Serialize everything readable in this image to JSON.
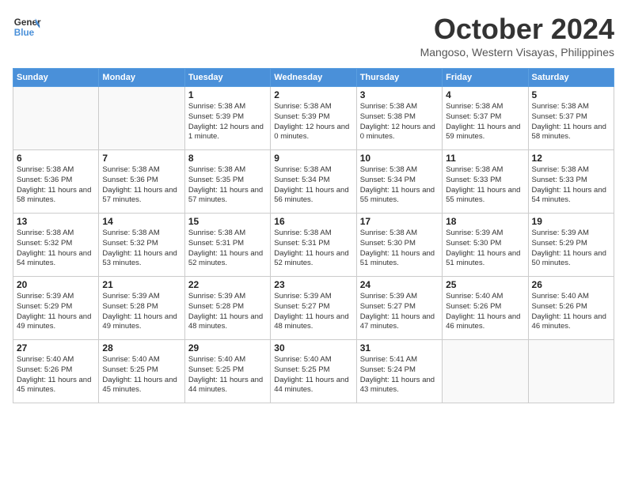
{
  "header": {
    "logo_line1": "General",
    "logo_line2": "Blue",
    "month_year": "October 2024",
    "location": "Mangoso, Western Visayas, Philippines"
  },
  "weekdays": [
    "Sunday",
    "Monday",
    "Tuesday",
    "Wednesday",
    "Thursday",
    "Friday",
    "Saturday"
  ],
  "weeks": [
    [
      {
        "day": "",
        "sunrise": "",
        "sunset": "",
        "daylight": ""
      },
      {
        "day": "",
        "sunrise": "",
        "sunset": "",
        "daylight": ""
      },
      {
        "day": "1",
        "sunrise": "Sunrise: 5:38 AM",
        "sunset": "Sunset: 5:39 PM",
        "daylight": "Daylight: 12 hours and 1 minute."
      },
      {
        "day": "2",
        "sunrise": "Sunrise: 5:38 AM",
        "sunset": "Sunset: 5:39 PM",
        "daylight": "Daylight: 12 hours and 0 minutes."
      },
      {
        "day": "3",
        "sunrise": "Sunrise: 5:38 AM",
        "sunset": "Sunset: 5:38 PM",
        "daylight": "Daylight: 12 hours and 0 minutes."
      },
      {
        "day": "4",
        "sunrise": "Sunrise: 5:38 AM",
        "sunset": "Sunset: 5:37 PM",
        "daylight": "Daylight: 11 hours and 59 minutes."
      },
      {
        "day": "5",
        "sunrise": "Sunrise: 5:38 AM",
        "sunset": "Sunset: 5:37 PM",
        "daylight": "Daylight: 11 hours and 58 minutes."
      }
    ],
    [
      {
        "day": "6",
        "sunrise": "Sunrise: 5:38 AM",
        "sunset": "Sunset: 5:36 PM",
        "daylight": "Daylight: 11 hours and 58 minutes."
      },
      {
        "day": "7",
        "sunrise": "Sunrise: 5:38 AM",
        "sunset": "Sunset: 5:36 PM",
        "daylight": "Daylight: 11 hours and 57 minutes."
      },
      {
        "day": "8",
        "sunrise": "Sunrise: 5:38 AM",
        "sunset": "Sunset: 5:35 PM",
        "daylight": "Daylight: 11 hours and 57 minutes."
      },
      {
        "day": "9",
        "sunrise": "Sunrise: 5:38 AM",
        "sunset": "Sunset: 5:34 PM",
        "daylight": "Daylight: 11 hours and 56 minutes."
      },
      {
        "day": "10",
        "sunrise": "Sunrise: 5:38 AM",
        "sunset": "Sunset: 5:34 PM",
        "daylight": "Daylight: 11 hours and 55 minutes."
      },
      {
        "day": "11",
        "sunrise": "Sunrise: 5:38 AM",
        "sunset": "Sunset: 5:33 PM",
        "daylight": "Daylight: 11 hours and 55 minutes."
      },
      {
        "day": "12",
        "sunrise": "Sunrise: 5:38 AM",
        "sunset": "Sunset: 5:33 PM",
        "daylight": "Daylight: 11 hours and 54 minutes."
      }
    ],
    [
      {
        "day": "13",
        "sunrise": "Sunrise: 5:38 AM",
        "sunset": "Sunset: 5:32 PM",
        "daylight": "Daylight: 11 hours and 54 minutes."
      },
      {
        "day": "14",
        "sunrise": "Sunrise: 5:38 AM",
        "sunset": "Sunset: 5:32 PM",
        "daylight": "Daylight: 11 hours and 53 minutes."
      },
      {
        "day": "15",
        "sunrise": "Sunrise: 5:38 AM",
        "sunset": "Sunset: 5:31 PM",
        "daylight": "Daylight: 11 hours and 52 minutes."
      },
      {
        "day": "16",
        "sunrise": "Sunrise: 5:38 AM",
        "sunset": "Sunset: 5:31 PM",
        "daylight": "Daylight: 11 hours and 52 minutes."
      },
      {
        "day": "17",
        "sunrise": "Sunrise: 5:38 AM",
        "sunset": "Sunset: 5:30 PM",
        "daylight": "Daylight: 11 hours and 51 minutes."
      },
      {
        "day": "18",
        "sunrise": "Sunrise: 5:39 AM",
        "sunset": "Sunset: 5:30 PM",
        "daylight": "Daylight: 11 hours and 51 minutes."
      },
      {
        "day": "19",
        "sunrise": "Sunrise: 5:39 AM",
        "sunset": "Sunset: 5:29 PM",
        "daylight": "Daylight: 11 hours and 50 minutes."
      }
    ],
    [
      {
        "day": "20",
        "sunrise": "Sunrise: 5:39 AM",
        "sunset": "Sunset: 5:29 PM",
        "daylight": "Daylight: 11 hours and 49 minutes."
      },
      {
        "day": "21",
        "sunrise": "Sunrise: 5:39 AM",
        "sunset": "Sunset: 5:28 PM",
        "daylight": "Daylight: 11 hours and 49 minutes."
      },
      {
        "day": "22",
        "sunrise": "Sunrise: 5:39 AM",
        "sunset": "Sunset: 5:28 PM",
        "daylight": "Daylight: 11 hours and 48 minutes."
      },
      {
        "day": "23",
        "sunrise": "Sunrise: 5:39 AM",
        "sunset": "Sunset: 5:27 PM",
        "daylight": "Daylight: 11 hours and 48 minutes."
      },
      {
        "day": "24",
        "sunrise": "Sunrise: 5:39 AM",
        "sunset": "Sunset: 5:27 PM",
        "daylight": "Daylight: 11 hours and 47 minutes."
      },
      {
        "day": "25",
        "sunrise": "Sunrise: 5:40 AM",
        "sunset": "Sunset: 5:26 PM",
        "daylight": "Daylight: 11 hours and 46 minutes."
      },
      {
        "day": "26",
        "sunrise": "Sunrise: 5:40 AM",
        "sunset": "Sunset: 5:26 PM",
        "daylight": "Daylight: 11 hours and 46 minutes."
      }
    ],
    [
      {
        "day": "27",
        "sunrise": "Sunrise: 5:40 AM",
        "sunset": "Sunset: 5:26 PM",
        "daylight": "Daylight: 11 hours and 45 minutes."
      },
      {
        "day": "28",
        "sunrise": "Sunrise: 5:40 AM",
        "sunset": "Sunset: 5:25 PM",
        "daylight": "Daylight: 11 hours and 45 minutes."
      },
      {
        "day": "29",
        "sunrise": "Sunrise: 5:40 AM",
        "sunset": "Sunset: 5:25 PM",
        "daylight": "Daylight: 11 hours and 44 minutes."
      },
      {
        "day": "30",
        "sunrise": "Sunrise: 5:40 AM",
        "sunset": "Sunset: 5:25 PM",
        "daylight": "Daylight: 11 hours and 44 minutes."
      },
      {
        "day": "31",
        "sunrise": "Sunrise: 5:41 AM",
        "sunset": "Sunset: 5:24 PM",
        "daylight": "Daylight: 11 hours and 43 minutes."
      },
      {
        "day": "",
        "sunrise": "",
        "sunset": "",
        "daylight": ""
      },
      {
        "day": "",
        "sunrise": "",
        "sunset": "",
        "daylight": ""
      }
    ]
  ]
}
